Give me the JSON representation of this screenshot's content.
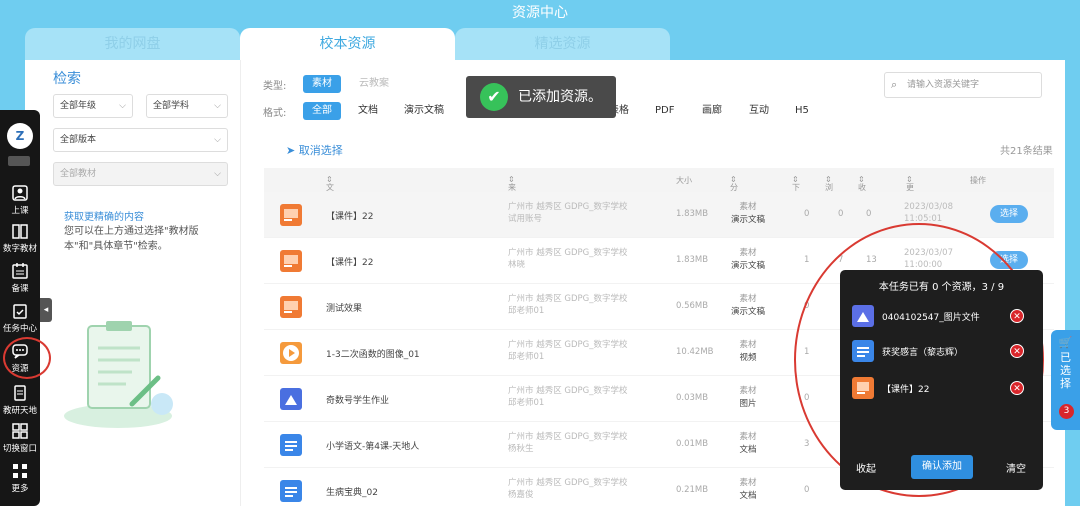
{
  "app_title": "资源中心",
  "tabs": [
    "我的网盘",
    "校本资源",
    "精选资源"
  ],
  "dock": {
    "items": [
      "上课",
      "数字教材",
      "备课",
      "任务中心",
      "资源",
      "教研天地",
      "切换窗口",
      "更多"
    ]
  },
  "filter": {
    "title": "检索",
    "selects": [
      "全部年级",
      "全部学科",
      "全部版本",
      "全部教材"
    ],
    "hint_link": "获取更精确的内容",
    "hint_text": "您可以在上方通过选择\"教材版本\"和\"具体章节\"检索。"
  },
  "type_row": {
    "label": "类型:",
    "options": [
      "素材",
      "云教案"
    ]
  },
  "format_row": {
    "label": "格式:",
    "options": [
      "全部",
      "文档",
      "演示文稿",
      "图片",
      "视频",
      "音频",
      "表格",
      "PDF",
      "画廊",
      "互动",
      "H5"
    ]
  },
  "search": {
    "placeholder": "请输入资源关键字"
  },
  "toast": {
    "text": "已添加资源。"
  },
  "cancel_selection": "取消选择",
  "result_count": "共21条结果",
  "table": {
    "headers": [
      "文件名",
      "来源",
      "大小",
      "分类 / 格式",
      "下载",
      "浏览",
      "收藏",
      "更新时间",
      "操作"
    ],
    "rows": [
      {
        "name": "【课件】22",
        "src1": "广州市 越秀区 GDPG_数字学校",
        "src2": "试用账号",
        "size": "1.83MB",
        "cat": "素材",
        "fmt": "演示文稿",
        "d": "0",
        "v": "0",
        "c": "0",
        "t1": "2023/03/08",
        "t2": "11:05:01",
        "btn": "选择",
        "icon": "ppt"
      },
      {
        "name": "【课件】22",
        "src1": "广州市 越秀区 GDPG_数字学校",
        "src2": "林晓",
        "size": "1.83MB",
        "cat": "素材",
        "fmt": "演示文稿",
        "d": "1",
        "v": "7",
        "c": "13",
        "t1": "2023/03/07",
        "t2": "11:00:00",
        "btn": "选择",
        "icon": "ppt"
      },
      {
        "name": "测试效果",
        "src1": "广州市 越秀区 GDPG_数字学校",
        "src2": "邱老师01",
        "size": "0.56MB",
        "cat": "素材",
        "fmt": "演示文稿",
        "d": "0",
        "v": "",
        "c": "",
        "t1": "",
        "t2": "",
        "btn": "",
        "icon": "ppt"
      },
      {
        "name": "1-3二次函数的图像_01",
        "src1": "广州市 越秀区 GDPG_数字学校",
        "src2": "邱老师01",
        "size": "10.42MB",
        "cat": "素材",
        "fmt": "视频",
        "d": "1",
        "v": "",
        "c": "",
        "t1": "",
        "t2": "",
        "btn": "",
        "icon": "video"
      },
      {
        "name": "奇数号学生作业",
        "src1": "广州市 越秀区 GDPG_数字学校",
        "src2": "邱老师01",
        "size": "0.03MB",
        "cat": "素材",
        "fmt": "图片",
        "d": "0",
        "v": "",
        "c": "",
        "t1": "",
        "t2": "",
        "btn": "",
        "icon": "image"
      },
      {
        "name": "小学语文-第4课-天地人",
        "src1": "广州市 越秀区 GDPG_数字学校",
        "src2": "杨秋生",
        "size": "0.01MB",
        "cat": "素材",
        "fmt": "文档",
        "d": "3",
        "v": "",
        "c": "",
        "t1": "",
        "t2": "",
        "btn": "",
        "icon": "doc"
      },
      {
        "name": "生病宝典_02",
        "src1": "广州市 越秀区 GDPG_数字学校",
        "src2": "杨嘉俊",
        "size": "0.21MB",
        "cat": "素材",
        "fmt": "文档",
        "d": "0",
        "v": "",
        "c": "",
        "t1": "",
        "t2": "",
        "btn": "",
        "icon": "doc"
      }
    ]
  },
  "popup": {
    "title": "本任务已有 0 个资源，3 / 9",
    "items": [
      {
        "label": "0404102547_图片文件",
        "icon": "image"
      },
      {
        "label": "获奖感言（黎志辉）",
        "icon": "doc"
      },
      {
        "label": "【课件】22",
        "icon": "ppt"
      }
    ],
    "collapse": "收起",
    "confirm": "确认添加",
    "clear": "清空"
  },
  "selected_tab": {
    "label": "已选择",
    "count": "3"
  },
  "colors": {
    "ppt": "#f07a34",
    "video": "#f59a3c",
    "image": "#4a6fe0",
    "doc": "#3a86e8",
    "accent": "#3aa0e8",
    "danger": "#d9262b"
  }
}
